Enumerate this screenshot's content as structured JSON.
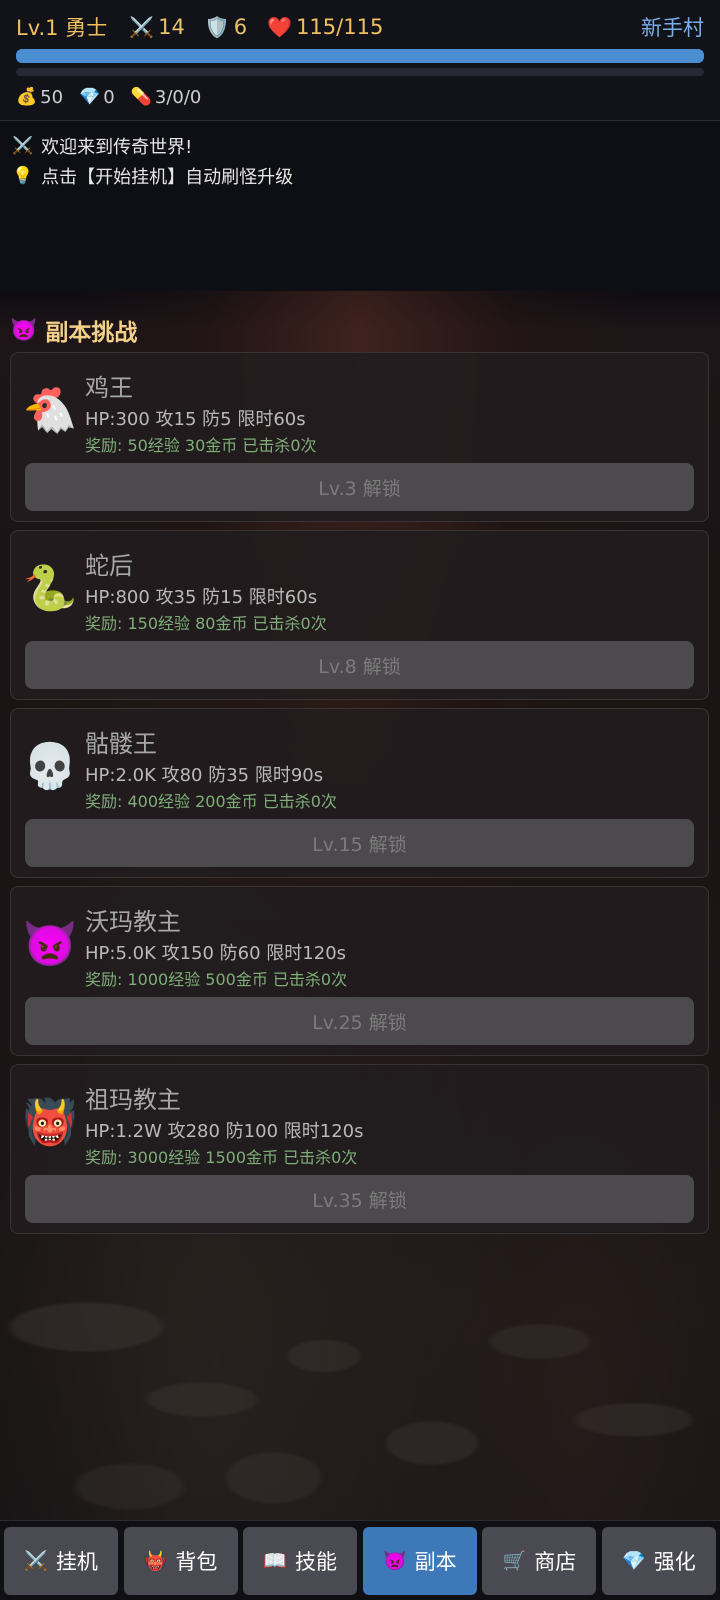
{
  "player": {
    "level": "Lv.1",
    "class": "勇士",
    "attack": "14",
    "defense": "6",
    "hp": "115/115",
    "hp_fraction": 1.0,
    "exp_fraction": 0.0,
    "location": "新手村"
  },
  "resources": {
    "gold": "50",
    "gems": "0",
    "potions": "3/0/0"
  },
  "log": [
    {
      "icon": "crossed-swords-icon",
      "text": "欢迎来到传奇世界!"
    },
    {
      "icon": "lightbulb-icon",
      "text": "点击【开始挂机】自动刷怪升级"
    }
  ],
  "section": {
    "title": "副本挑战"
  },
  "dungeons": [
    {
      "icon": "🐔",
      "name": "鸡王",
      "stats": "HP:300  攻15  防5   限时60s",
      "reward": "奖励: 50经验  30金币   已击杀0次",
      "button": "Lv.3  解锁"
    },
    {
      "icon": "🐍",
      "name": "蛇后",
      "stats": "HP:800  攻35  防15   限时60s",
      "reward": "奖励: 150经验  80金币   已击杀0次",
      "button": "Lv.8  解锁"
    },
    {
      "icon": "💀",
      "name": "骷髅王",
      "stats": "HP:2.0K  攻80  防35   限时90s",
      "reward": "奖励: 400经验  200金币   已击杀0次",
      "button": "Lv.15  解锁"
    },
    {
      "icon": "👿",
      "name": "沃玛教主",
      "stats": "HP:5.0K  攻150  防60   限时120s",
      "reward": "奖励: 1000经验  500金币   已击杀0次",
      "button": "Lv.25  解锁"
    },
    {
      "icon": "👹",
      "name": "祖玛教主",
      "stats": "HP:1.2W  攻280  防100   限时120s",
      "reward": "奖励: 3000经验  1500金币   已击杀0次",
      "button": "Lv.35  解锁"
    }
  ],
  "nav": [
    {
      "icon": "⚔️",
      "label": "挂机",
      "active": false
    },
    {
      "icon": "👹",
      "label": "背包",
      "active": false
    },
    {
      "icon": "📖",
      "label": "技能",
      "active": false
    },
    {
      "icon": "👿",
      "label": "副本",
      "active": true
    },
    {
      "icon": "🛒",
      "label": "商店",
      "active": false
    },
    {
      "icon": "💎",
      "label": "强化",
      "active": false
    }
  ],
  "colors": {
    "accent_gold": "#f0c060",
    "location_blue": "#7aaeea",
    "hp_bar": "#4a8fd2",
    "nav_active": "#3d78b8",
    "reward_green": "#7fae78"
  }
}
